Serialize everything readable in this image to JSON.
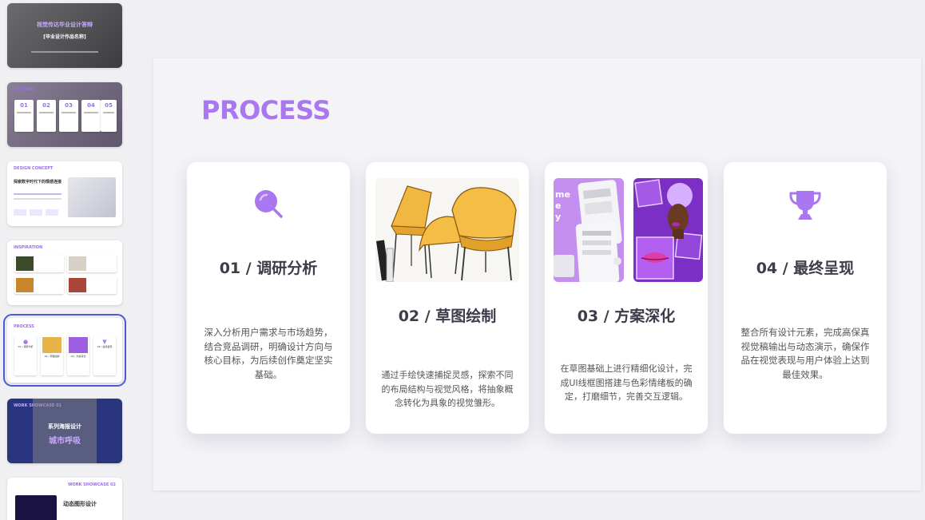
{
  "sidebar": {
    "slides": [
      {
        "title": "视觉传达毕业设计答辩",
        "subtitle": "[毕业设计作品名称]"
      },
      {
        "label": "CONTENT",
        "nums": [
          "01",
          "02",
          "03",
          "04",
          "05"
        ]
      },
      {
        "label": "DESIGN CONCEPT",
        "heading": "探索数字时代下的情感连接"
      },
      {
        "label": "INSPIRATION"
      },
      {
        "label": "PROCESS",
        "items": [
          "01 / 调研分析",
          "02 / 草图绘制",
          "03 / 方案深化",
          "04 / 最终呈现"
        ]
      },
      {
        "label": "WORK SHOWCASE 01",
        "heading": "系列海报设计",
        "subheading": "城市呼吸"
      },
      {
        "label": "WORK SHOWCASE 02",
        "heading": "动态图形设计"
      }
    ]
  },
  "slide": {
    "title": "PROCESS",
    "cards": [
      {
        "heading": "01 / 调研分析",
        "desc": "深入分析用户需求与市场趋势，结合竞品调研，明确设计方向与核心目标，为后续创作奠定坚实基础。",
        "icon": "search-icon"
      },
      {
        "heading": "02 / 草图绘制",
        "desc": "通过手绘快速捕捉灵感，探索不同的布局结构与视觉风格，将抽象概念转化为具象的视觉雏形。",
        "image": "chair-sketch-image"
      },
      {
        "heading": "03 / 方案深化",
        "desc": "在草图基础上进行精细化设计，完成UI线框图搭建与色彩情绪板的确定，打磨细节，完善交互逻辑。",
        "image": "wireframe-moodboard-image"
      },
      {
        "heading": "04 / 最终呈现",
        "desc": "整合所有设计元素，完成高保真视觉稿输出与动态演示，确保作品在视觉表现与用户体验上达到最佳效果。",
        "icon": "trophy-icon"
      }
    ]
  },
  "colors": {
    "accent": "#a978f0",
    "heading": "#3c3c4a",
    "selected": "#4b5bd6"
  }
}
